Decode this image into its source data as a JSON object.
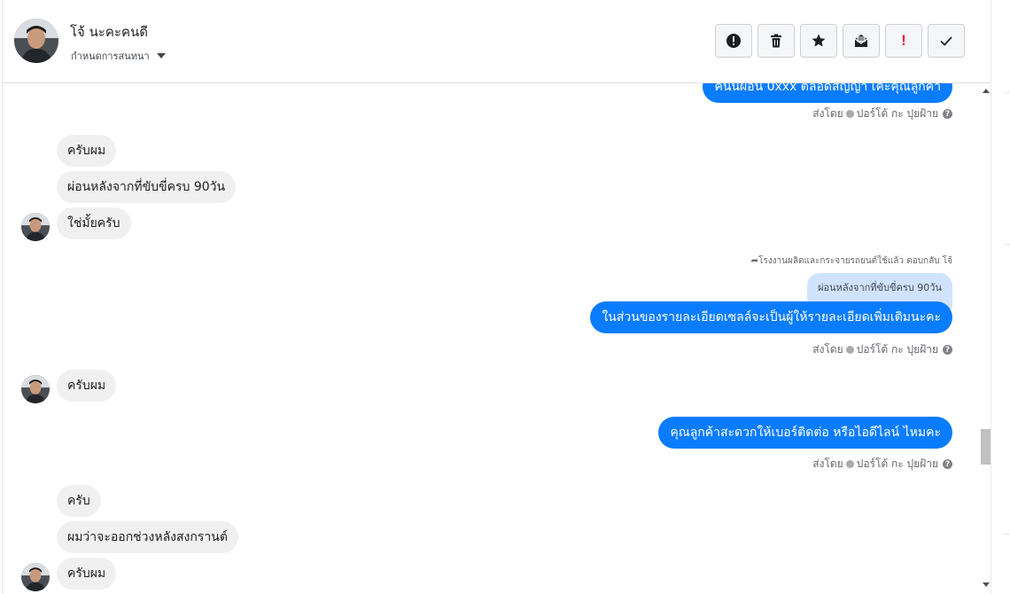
{
  "header": {
    "contact_name": "โจ้ นะคะคนดี",
    "assign_label": "กำหนดการสนทนา",
    "actions": [
      {
        "name": "mark-spam-button",
        "icon": "alert-circle-icon"
      },
      {
        "name": "delete-button",
        "icon": "trash-icon"
      },
      {
        "name": "star-button",
        "icon": "star-icon"
      },
      {
        "name": "mark-unread-button",
        "icon": "envelope-open-icon"
      },
      {
        "name": "follow-up-button",
        "icon": "exclamation-icon"
      },
      {
        "name": "mark-done-button",
        "icon": "checkmark-icon"
      }
    ]
  },
  "colors": {
    "outgoing_bubble": "#0a7cff",
    "incoming_bubble": "#f1f0f0",
    "reply_quote": "#cfe3ff",
    "follow_up_red": "#e41e3f"
  },
  "messages": {
    "m0_partial": "ค่นนผอน 0xxx ตลอดสญญา เคะคุณลูกคา",
    "m0_meta": {
      "prefix": "ส่งโดย",
      "sender": "ปอร์โต้ กะ ปุยฝ้าย"
    },
    "in1": "ครับผม",
    "in2": "ผ่อนหลังจากที่ขับขี่ครบ 90วัน",
    "in3": "ใช่มั้ยครับ",
    "reply_meta": "โรงงานผลิตและกระจายรถยนต์ใช้แล้ว ตอบกลับ โจ้",
    "reply_quote": "ผ่อนหลังจากที่ขับขี่ครบ 90วัน",
    "out2": "ในส่วนของรายละเอียดเซลล์จะเป็นผู้ให้รายละเอียดเพิ่มเติมนะคะ",
    "out2_meta": {
      "prefix": "ส่งโดย",
      "sender": "ปอร์โต้ กะ ปุยฝ้าย"
    },
    "in4": "ครับผม",
    "out3": "คุณลูกค้าสะดวกให้เบอร์ติดต่อ หรือไอดีไลน์ ไหมคะ",
    "out3_meta": {
      "prefix": "ส่งโดย",
      "sender": "ปอร์โต้ กะ ปุยฝ้าย"
    },
    "in5": "ครับ",
    "in6": "ผมว่าจะออกช่วงหลังสงกรานต์",
    "in7": "ครับผม"
  }
}
